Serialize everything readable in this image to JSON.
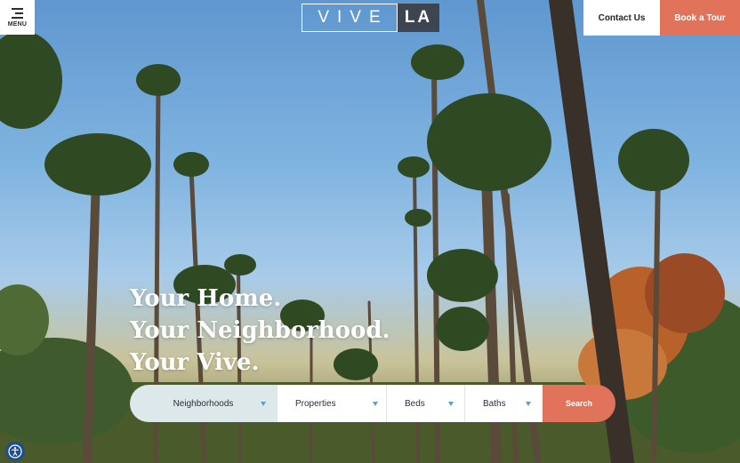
{
  "menu": {
    "label": "MENU",
    "icon": "hamburger-icon"
  },
  "logo": {
    "left": "VIVE",
    "right": "LA"
  },
  "header": {
    "contact_label": "Contact Us",
    "tour_label": "Book a Tour"
  },
  "hero": {
    "lines": [
      "Your Home.",
      "Your Neighborhood.",
      "Your Vive."
    ]
  },
  "search": {
    "neighborhoods": "Neighborhoods",
    "properties": "Properties",
    "beds": "Beds",
    "baths": "Baths",
    "button": "Search"
  },
  "accessibility": {
    "icon": "accessibility-icon"
  },
  "colors": {
    "accent": "#e0735a",
    "dark": "#3d4650",
    "caret": "#5aa2b8"
  }
}
